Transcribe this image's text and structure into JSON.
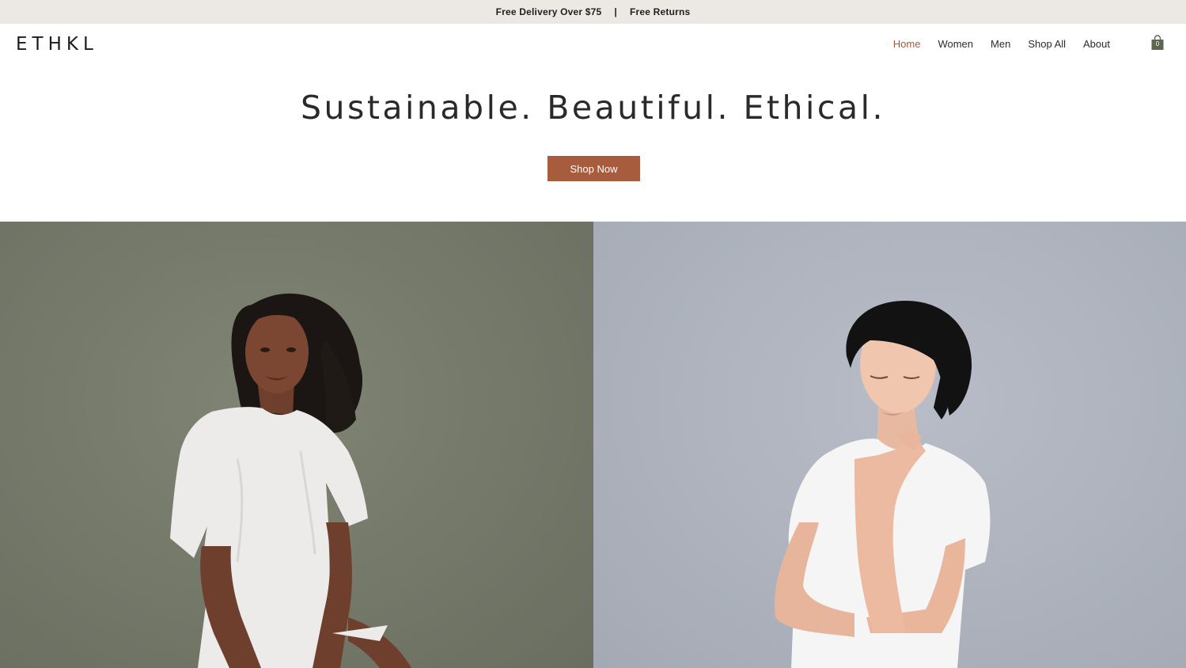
{
  "announcement": {
    "left_text": "Free Delivery Over $75",
    "separator": "|",
    "right_text": "Free Returns"
  },
  "header": {
    "logo": "ETHKL",
    "nav": [
      {
        "label": "Home",
        "active": true
      },
      {
        "label": "Women",
        "active": false
      },
      {
        "label": "Men",
        "active": false
      },
      {
        "label": "Shop All",
        "active": false
      },
      {
        "label": "About",
        "active": false
      }
    ],
    "cart": {
      "icon": "shopping-bag-icon",
      "count": "0"
    }
  },
  "hero": {
    "title": "Sustainable. Beautiful. Ethical.",
    "cta_label": "Shop Now"
  },
  "colors": {
    "accent": "#a85c3e",
    "nav_active": "#a65a3d",
    "announce_bg": "#ece8e3",
    "left_panel_bg": "#747869",
    "right_panel_bg": "#adb2bc",
    "cart_icon": "#5e6652"
  }
}
